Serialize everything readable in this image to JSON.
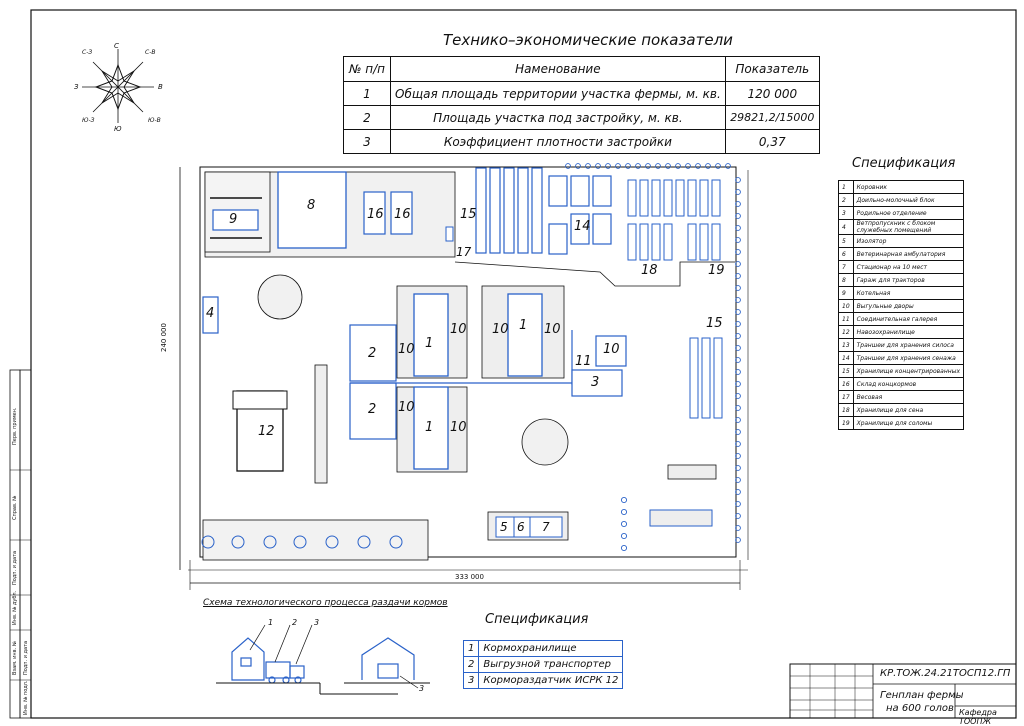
{
  "te": {
    "title": "Технико–экономические показатели",
    "headers": [
      "№ п/п",
      "Наменование",
      "Показатель"
    ],
    "rows": [
      {
        "n": "1",
        "name": "Общая площадь территории участка фермы, м. кв.",
        "value": "120 000"
      },
      {
        "n": "2",
        "name": "Площадь участка под застройку, м. кв.",
        "value": "29821,2/15000"
      },
      {
        "n": "3",
        "name": "Коэффициент плотности застройки",
        "value": "0,37"
      }
    ]
  },
  "compass": {
    "top": "С",
    "bottom": "Ю",
    "left": "З",
    "right": "В",
    "nw": "С-З",
    "ne": "С-В",
    "sw": "Ю-З",
    "se": "Ю-В"
  },
  "spec_right": {
    "title": "Спецификация",
    "items": [
      {
        "n": "1",
        "label": "Коровник"
      },
      {
        "n": "2",
        "label": "Доильно-молочный блок"
      },
      {
        "n": "3",
        "label": "Родильное отделение"
      },
      {
        "n": "4",
        "label": "Ветпропускник с блоком служебных помещений"
      },
      {
        "n": "5",
        "label": "Изолятор"
      },
      {
        "n": "6",
        "label": "Ветеринарная амбулатория"
      },
      {
        "n": "7",
        "label": "Стационар на 10 мест"
      },
      {
        "n": "8",
        "label": "Гараж для тракторов"
      },
      {
        "n": "9",
        "label": "Котельная"
      },
      {
        "n": "10",
        "label": "Выгульные дворы"
      },
      {
        "n": "11",
        "label": "Соединительная галерея"
      },
      {
        "n": "12",
        "label": "Навозохранилище"
      },
      {
        "n": "13",
        "label": "Траншеи для хранения силоса"
      },
      {
        "n": "14",
        "label": "Траншеи для хранения сенажа"
      },
      {
        "n": "15",
        "label": "Хранилище концентрированных"
      },
      {
        "n": "16",
        "label": "Склад концкормов"
      },
      {
        "n": "17",
        "label": "Весовая"
      },
      {
        "n": "18",
        "label": "Хранилище для сена"
      },
      {
        "n": "19",
        "label": "Хранилище для соломы"
      }
    ]
  },
  "plan": {
    "dim_width": "333 000",
    "dim_height": "240 000",
    "labels": {
      "b1a": "1",
      "b1b": "1",
      "b1c": "1",
      "b2a": "2",
      "b2b": "2",
      "b3": "3",
      "b4": "4",
      "b5": "5",
      "b6": "6",
      "b7": "7",
      "b8": "8",
      "b9": "9",
      "b10a": "10",
      "b10b": "10",
      "b10c": "10",
      "b10d": "10",
      "b10e": "10",
      "b10f": "10",
      "b10g": "10",
      "b11": "11",
      "b12": "12",
      "b14": "14",
      "b15a": "15",
      "b15b": "15",
      "b16a": "16",
      "b16b": "16",
      "b17": "17",
      "b18": "18",
      "b19": "19"
    }
  },
  "scheme": {
    "title": "Схема технологического процесса раздачи кормов",
    "callouts": [
      "1",
      "2",
      "3",
      "3"
    ]
  },
  "spec_bottom": {
    "title": "Спецификация",
    "items": [
      {
        "n": "1",
        "label": "Кормохранилище"
      },
      {
        "n": "2",
        "label": "Выгрузной транспортер"
      },
      {
        "n": "3",
        "label": "Кормораздатчик ИСРК 12"
      }
    ]
  },
  "stamp": {
    "code": "КР.ТОЖ.24.21ТОСП12.ГП",
    "title_line1": "Генплан фермы",
    "title_line2": "на 600 голов",
    "org": "Кафедра ТООПЖ"
  },
  "side_labels": [
    "Перв. примен.",
    "Справ. №",
    "Подп. и дата",
    "Инв. № дубл.",
    "Взам. инв. №",
    "Подп. и дата",
    "Инв. № подл."
  ]
}
